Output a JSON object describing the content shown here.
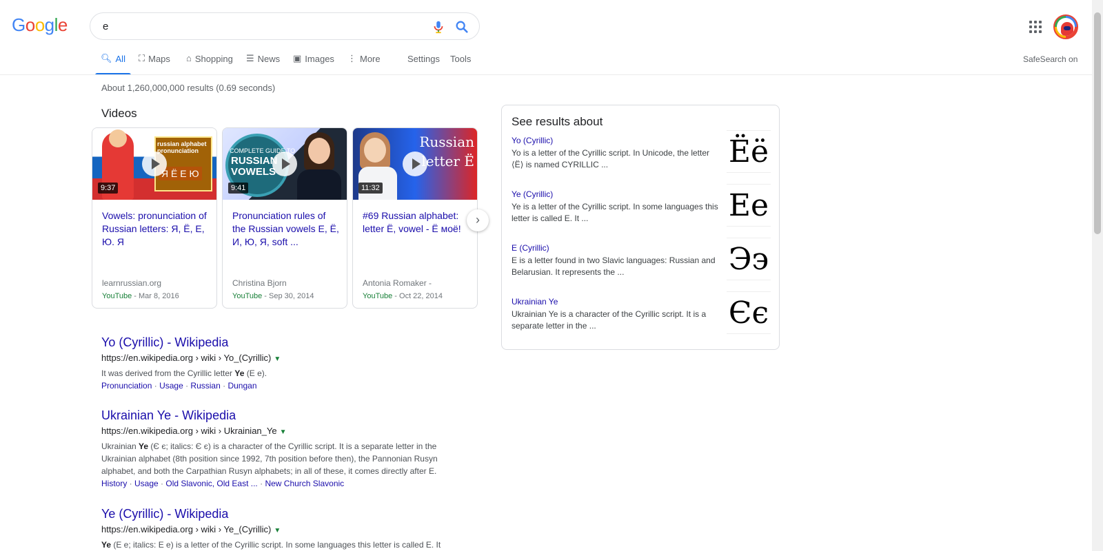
{
  "logo": [
    "G",
    "o",
    "o",
    "g",
    "l",
    "e"
  ],
  "logo_colors": [
    "#4285f4",
    "#ea4335",
    "#fbbc05",
    "#4285f4",
    "#34a853",
    "#ea4335"
  ],
  "search": {
    "query": "e"
  },
  "icons": {
    "mic": "mic-icon",
    "search": "search-icon",
    "apps": "apps-grid-icon",
    "avatar": "account-avatar"
  },
  "tabs": [
    {
      "label": "All",
      "icon": "🔍︎"
    },
    {
      "label": "Maps",
      "icon": "⛶"
    },
    {
      "label": "Shopping",
      "icon": "⌂"
    },
    {
      "label": "News",
      "icon": "☰"
    },
    {
      "label": "Images",
      "icon": "▣"
    },
    {
      "label": "More",
      "icon": "⋮"
    },
    {
      "label": "Settings"
    },
    {
      "label": "Tools"
    }
  ],
  "safesearch": "SafeSearch on",
  "stats": "About 1,260,000,000 results (0.69 seconds)",
  "videos": {
    "title": "Videos",
    "items": [
      {
        "duration": "9:37",
        "thumb_text": "Я Ё Е Ю",
        "thumb_sub": "russian alphabet pronunciation",
        "title": "Vowels: pronunciation of Russian letters: Я, Ё, Е, Ю. Я",
        "source": "learnrussian.org",
        "platform": "YouTube",
        "date": " - Mar 8, 2016"
      },
      {
        "duration": "9:41",
        "thumb_text": "RUSSIAN VOWELS",
        "thumb_sub": "COMPLETE GUIDE TO",
        "title": "Pronunciation rules of the Russian vowels Е, Ё, И, Ю, Я, soft ...",
        "source": "Christina Bjorn",
        "platform": "YouTube",
        "date": " - Sep 30, 2014"
      },
      {
        "duration": "11:32",
        "thumb_text": "Russian letter Ё",
        "title": "#69 Russian alphabet: letter Ё, vowel - Ё моё!",
        "source": "Antonia Romaker -",
        "platform": "YouTube",
        "date": " - Oct 22, 2014"
      }
    ],
    "next_icon": "chevron-right-icon"
  },
  "results": [
    {
      "title": "Yo (Cyrillic) - Wikipedia",
      "url": "https://en.wikipedia.org › wiki › Yo_(Cyrillic)",
      "snippet_pre": "It was derived from the Cyrillic letter ",
      "snippet_bold": "Ye",
      "snippet_post": " (Е е).",
      "links": [
        "Pronunciation",
        "Usage",
        "Russian",
        "Dungan"
      ]
    },
    {
      "title": "Ukrainian Ye - Wikipedia",
      "url": "https://en.wikipedia.org › wiki › Ukrainian_Ye",
      "snippet_pre": "Ukrainian ",
      "snippet_bold": "Ye",
      "snippet_post": " (Є є; italics: Є є) is a character of the Cyrillic script. It is a separate letter in the Ukrainian alphabet (8th position since 1992, 7th position before then), the Pannonian Rusyn alphabet, and both the Carpathian Rusyn alphabets; in all of these, it comes directly after Е.",
      "links": [
        "History",
        "Usage",
        "Old Slavonic, Old East ...",
        "New Church Slavonic"
      ]
    },
    {
      "title": "Ye (Cyrillic) - Wikipedia",
      "url": "https://en.wikipedia.org › wiki › Ye_(Cyrillic)",
      "snippet_pre": "",
      "snippet_bold": "Ye",
      "snippet_post": " (Е е; italics: Е е) is a letter of the Cyrillic script. In some languages this letter is called E. It",
      "links": []
    }
  ],
  "side": {
    "title": "See results about",
    "items": [
      {
        "link": "Yo (Cyrillic)",
        "desc": "Yo is a letter of the Cyrillic script. In Unicode, the letter ⟨Ё⟩ is named CYRILLIC ...",
        "glyph": "Ёё"
      },
      {
        "link": "Ye (Cyrillic)",
        "desc": "Ye is a letter of the Cyrillic script. In some languages this letter is called E. It ...",
        "glyph": "Ее"
      },
      {
        "link": "E (Cyrillic)",
        "desc": "E is a letter found in two Slavic languages: Russian and Belarusian. It represents the ...",
        "glyph": "Ээ"
      },
      {
        "link": "Ukrainian Ye",
        "desc": "Ukrainian Ye is a character of the Cyrillic script. It is a separate letter in the ...",
        "glyph": "Єє"
      }
    ]
  }
}
